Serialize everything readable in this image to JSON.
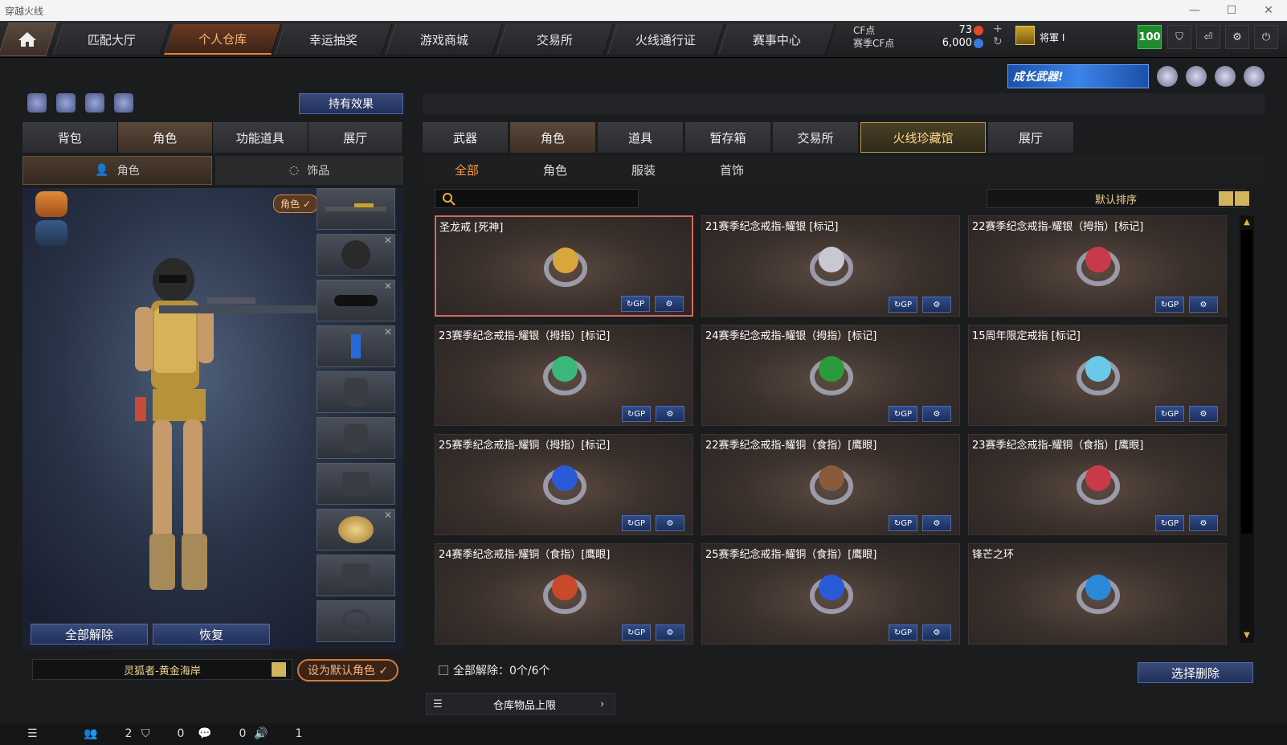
{
  "window": {
    "title": "穿越火线"
  },
  "nav": {
    "tabs": [
      "匹配大厅",
      "个人仓库",
      "幸运抽奖",
      "游戏商城",
      "交易所",
      "火线通行证",
      "赛事中心"
    ],
    "active": 1
  },
  "currency": {
    "cf_label": "CF点",
    "season_cf_label": "赛季CF点",
    "cf_value": "73",
    "season_cf_value": "6,000",
    "rank": "将軍 I",
    "level": "100"
  },
  "promo": {
    "label": "成长武器!"
  },
  "left_panel": {
    "hold_effect_label": "持有效果",
    "tabs": [
      "背包",
      "角色",
      "功能道具",
      "展厅"
    ],
    "active_tab": 1,
    "subtabs": [
      "角色",
      "饰品"
    ],
    "char_badge": "角色 ✓",
    "unequip_all_label": "全部解除",
    "restore_label": "恢复",
    "character_name": "灵狐者-黄金海岸",
    "set_default_label": "设为默认角色 ✓"
  },
  "right_panel": {
    "tabs": [
      "武器",
      "角色",
      "道具",
      "暂存箱",
      "交易所",
      "火线珍藏馆",
      "展厅"
    ],
    "active_tab": 1,
    "subtabs": [
      "全部",
      "角色",
      "服装",
      "首饰"
    ],
    "active_subtab": 0,
    "search_placeholder": "",
    "sort_label": "默认排序",
    "items": [
      {
        "name": "圣龙戒 [死神]",
        "color": "#d8a63a",
        "selected": true,
        "buttons": true
      },
      {
        "name": "21赛季纪念戒指-耀银 [标记]",
        "color": "#c8c8d0",
        "selected": false,
        "buttons": true
      },
      {
        "name": "22赛季纪念戒指-耀银（拇指）[标记]",
        "color": "#c83a4a",
        "selected": false,
        "buttons": true
      },
      {
        "name": "23赛季纪念戒指-耀银（拇指）[标记]",
        "color": "#3ab87a",
        "selected": false,
        "buttons": true
      },
      {
        "name": "24赛季纪念戒指-耀银（拇指）[标记]",
        "color": "#2a9a3a",
        "selected": false,
        "buttons": true
      },
      {
        "name": "15周年限定戒指 [标记]",
        "color": "#6ac8e8",
        "selected": false,
        "buttons": true
      },
      {
        "name": "25赛季纪念戒指-耀铜（拇指）[标记]",
        "color": "#2a5ad8",
        "selected": false,
        "buttons": true
      },
      {
        "name": "22赛季纪念戒指-耀铜（食指）[鹰眼]",
        "color": "#8a5a3a",
        "selected": false,
        "buttons": true
      },
      {
        "name": "23赛季纪念戒指-耀铜（食指）[鹰眼]",
        "color": "#c83a4a",
        "selected": false,
        "buttons": true
      },
      {
        "name": "24赛季纪念戒指-耀铜（食指）[鹰眼]",
        "color": "#c84a2a",
        "selected": false,
        "buttons": true
      },
      {
        "name": "25赛季纪念戒指-耀铜（食指）[鹰眼]",
        "color": "#2a5ad8",
        "selected": false,
        "buttons": true
      },
      {
        "name": "锋芒之环",
        "color": "#2a8ad8",
        "selected": false,
        "buttons": false
      }
    ],
    "gp_label": "GP",
    "unequip_info": "全部解除：0个/6个",
    "delete_label": "选择删除",
    "storage_label": "仓库物品上限"
  },
  "statusbar": {
    "friends": "2",
    "clan": "0",
    "chat": "0",
    "volume": "1"
  }
}
